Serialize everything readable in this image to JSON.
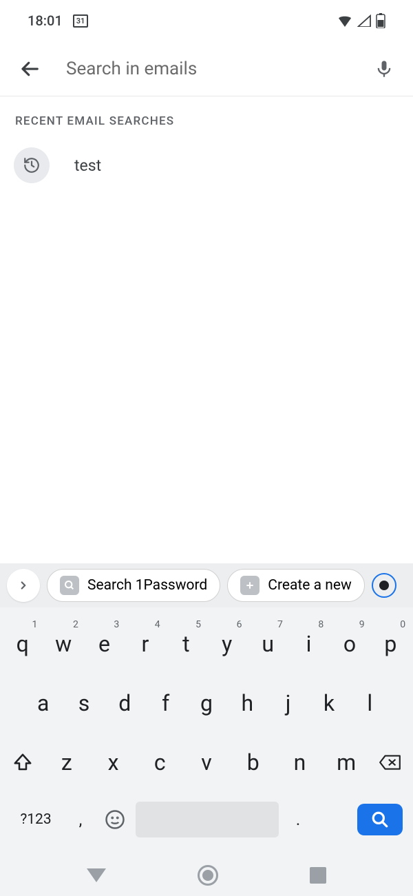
{
  "status": {
    "time": "18:01",
    "calendar_day": "31"
  },
  "search": {
    "placeholder": "Search in emails",
    "value": ""
  },
  "section": {
    "label": "RECENT EMAIL SEARCHES"
  },
  "recent": [
    {
      "text": "test"
    }
  ],
  "keyboard": {
    "suggestions": {
      "search_1password": "Search 1Password",
      "create_new": "Create a new"
    },
    "row1": [
      {
        "key": "q",
        "hint": "1"
      },
      {
        "key": "w",
        "hint": "2"
      },
      {
        "key": "e",
        "hint": "3"
      },
      {
        "key": "r",
        "hint": "4"
      },
      {
        "key": "t",
        "hint": "5"
      },
      {
        "key": "y",
        "hint": "6"
      },
      {
        "key": "u",
        "hint": "7"
      },
      {
        "key": "i",
        "hint": "8"
      },
      {
        "key": "o",
        "hint": "9"
      },
      {
        "key": "p",
        "hint": "0"
      }
    ],
    "row2": [
      "a",
      "s",
      "d",
      "f",
      "g",
      "h",
      "j",
      "k",
      "l"
    ],
    "row3": [
      "z",
      "x",
      "c",
      "v",
      "b",
      "n",
      "m"
    ],
    "sym": "?123",
    "comma": ",",
    "period": "."
  }
}
